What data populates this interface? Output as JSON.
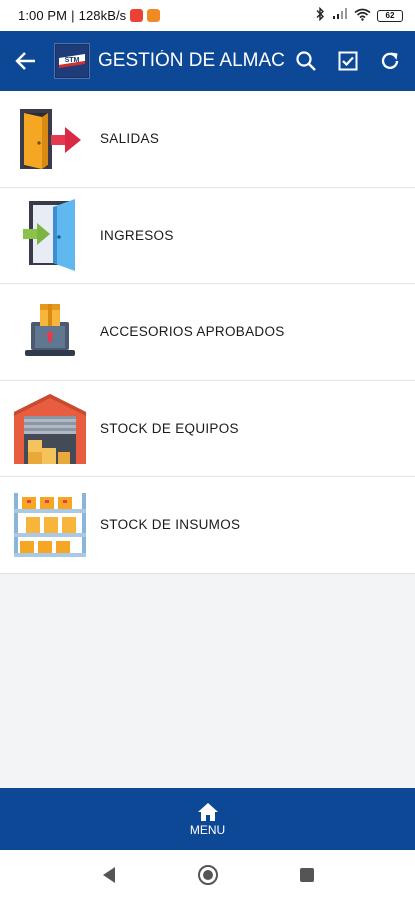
{
  "status_bar": {
    "time": "1:00 PM",
    "separator": "|",
    "network_speed": "128kB/s",
    "battery_level": "62",
    "icons": [
      "gmail-notification-icon",
      "app-notification-icon",
      "bluetooth-icon",
      "signal-icon",
      "wifi-icon",
      "battery-icon"
    ]
  },
  "app_bar": {
    "title": "GESTIÓN DE ALMACE",
    "logo_text": "STM",
    "icons": [
      "back-arrow-icon",
      "search-icon",
      "checkbox-icon",
      "refresh-icon"
    ],
    "color": "#0d4897"
  },
  "menu": {
    "items": [
      {
        "label": "SALIDAS",
        "icon": "exit-door-icon"
      },
      {
        "label": "INGRESOS",
        "icon": "entry-door-icon"
      },
      {
        "label": "ACCESORIOS APROBADOS",
        "icon": "laptop-box-icon"
      },
      {
        "label": "STOCK DE EQUIPOS",
        "icon": "warehouse-icon"
      },
      {
        "label": "STOCK DE INSUMOS",
        "icon": "shelves-icon"
      }
    ]
  },
  "bottom_nav": {
    "label": "MENU",
    "icon": "home-icon"
  },
  "system_nav": {
    "icons": [
      "nav-back-icon",
      "nav-home-icon",
      "nav-recents-icon"
    ]
  }
}
